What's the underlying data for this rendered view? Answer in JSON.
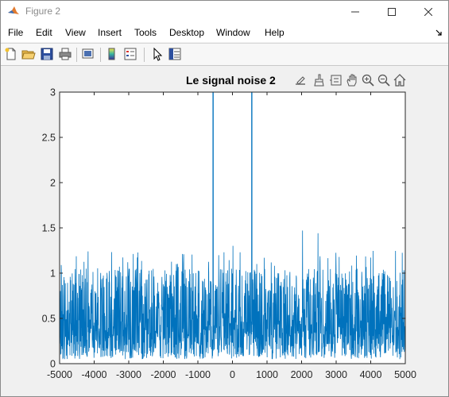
{
  "window": {
    "title": "Figure 2",
    "icons": {
      "app": "matlab-icon",
      "minimize": "minimize-icon",
      "maximize": "maximize-icon",
      "close": "close-icon"
    }
  },
  "menu": {
    "items": [
      "File",
      "Edit",
      "View",
      "Insert",
      "Tools",
      "Desktop",
      "Window",
      "Help"
    ],
    "dock_icon": "dock-arrow-icon"
  },
  "toolbar": {
    "buttons": [
      "new-figure-icon",
      "open-file-icon",
      "save-icon",
      "print-icon",
      "link-plot-icon",
      "insert-colorbar-icon",
      "insert-legend-icon",
      "edit-plot-icon",
      "property-inspector-icon"
    ]
  },
  "axes_toolbar": {
    "buttons": [
      "export-icon",
      "brush-icon",
      "data-tips-icon",
      "pan-icon",
      "zoom-in-icon",
      "zoom-out-icon",
      "home-icon"
    ]
  },
  "colors": {
    "line": "#0072bd",
    "axes_bg": "#ffffff",
    "figure_bg": "#f0f0f0"
  },
  "chart_data": {
    "type": "line",
    "title": "Le signal noise 2",
    "xlabel": "",
    "ylabel": "",
    "xlim": [
      -5000,
      5000
    ],
    "ylim": [
      0,
      3
    ],
    "xticks": [
      "-5000",
      "-4000",
      "-3000",
      "-2000",
      "-1000",
      "0",
      "1000",
      "2000",
      "3000",
      "4000",
      "5000"
    ],
    "yticks": [
      "0",
      "0.5",
      "1",
      "1.5",
      "2",
      "2.5",
      "3"
    ],
    "grid": false,
    "description_of_series": "dense noise magnitude spectrum mostly between 0 and 1.1 with peaks near 1.5",
    "peaks": [
      {
        "x": -560,
        "y": 3.0
      },
      {
        "x": 560,
        "y": 3.0
      }
    ],
    "noise": {
      "typical_min": 0.0,
      "typical_max": 1.1,
      "occasional_max": 1.5,
      "mean": 0.5
    }
  }
}
